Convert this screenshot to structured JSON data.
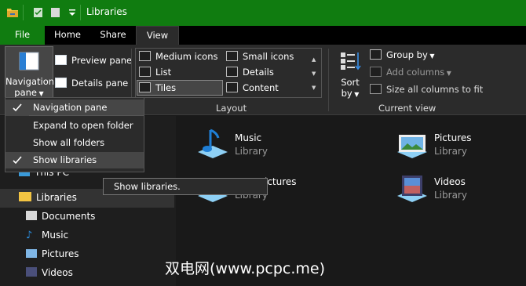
{
  "window": {
    "title": "Libraries"
  },
  "tabs": [
    {
      "label": "File"
    },
    {
      "label": "Home"
    },
    {
      "label": "Share"
    },
    {
      "label": "View"
    }
  ],
  "ribbon": {
    "navigation_pane": {
      "line1": "Navigation",
      "line2": "pane"
    },
    "preview_pane": "Preview pane",
    "details_pane": "Details pane",
    "layout_options": [
      "Medium icons",
      "Small icons",
      "List",
      "Details",
      "Tiles",
      "Content"
    ],
    "selected_layout": "Tiles",
    "layout_group_label": "Layout",
    "sort_by": {
      "line1": "Sort",
      "line2": "by"
    },
    "group_by": "Group by",
    "add_columns": "Add columns",
    "size_all_columns": "Size all columns to fit",
    "current_view_group_label": "Current view"
  },
  "nav_menu": {
    "items": [
      {
        "label": "Navigation pane",
        "checked": true
      },
      {
        "label": "Expand to open folder",
        "checked": false
      },
      {
        "label": "Show all folders",
        "checked": false
      },
      {
        "label": "Show libraries",
        "checked": true
      }
    ]
  },
  "tooltip": "Show libraries.",
  "nav_pane": {
    "this_pc": "This PC",
    "libraries": "Libraries",
    "children": [
      "Documents",
      "Music",
      "Pictures",
      "Videos"
    ]
  },
  "content": {
    "tiles": [
      {
        "name": "Music",
        "type": "Library",
        "icon": "music-library-icon"
      },
      {
        "name": "Pictures",
        "type": "Library",
        "icon": "pictures-library-icon"
      },
      {
        "name": "Pictures",
        "type": "Library",
        "icon": "camera-roll-library-icon",
        "partial": "ictures"
      },
      {
        "name": "Videos",
        "type": "Library",
        "icon": "videos-library-icon"
      }
    ]
  },
  "watermark": "双电网(www.pcpc.me)",
  "colors": {
    "accent": "#107c10",
    "ribbon_bg": "#2b2b2b",
    "window_bg": "#191919",
    "checked_bg": "#464646"
  }
}
